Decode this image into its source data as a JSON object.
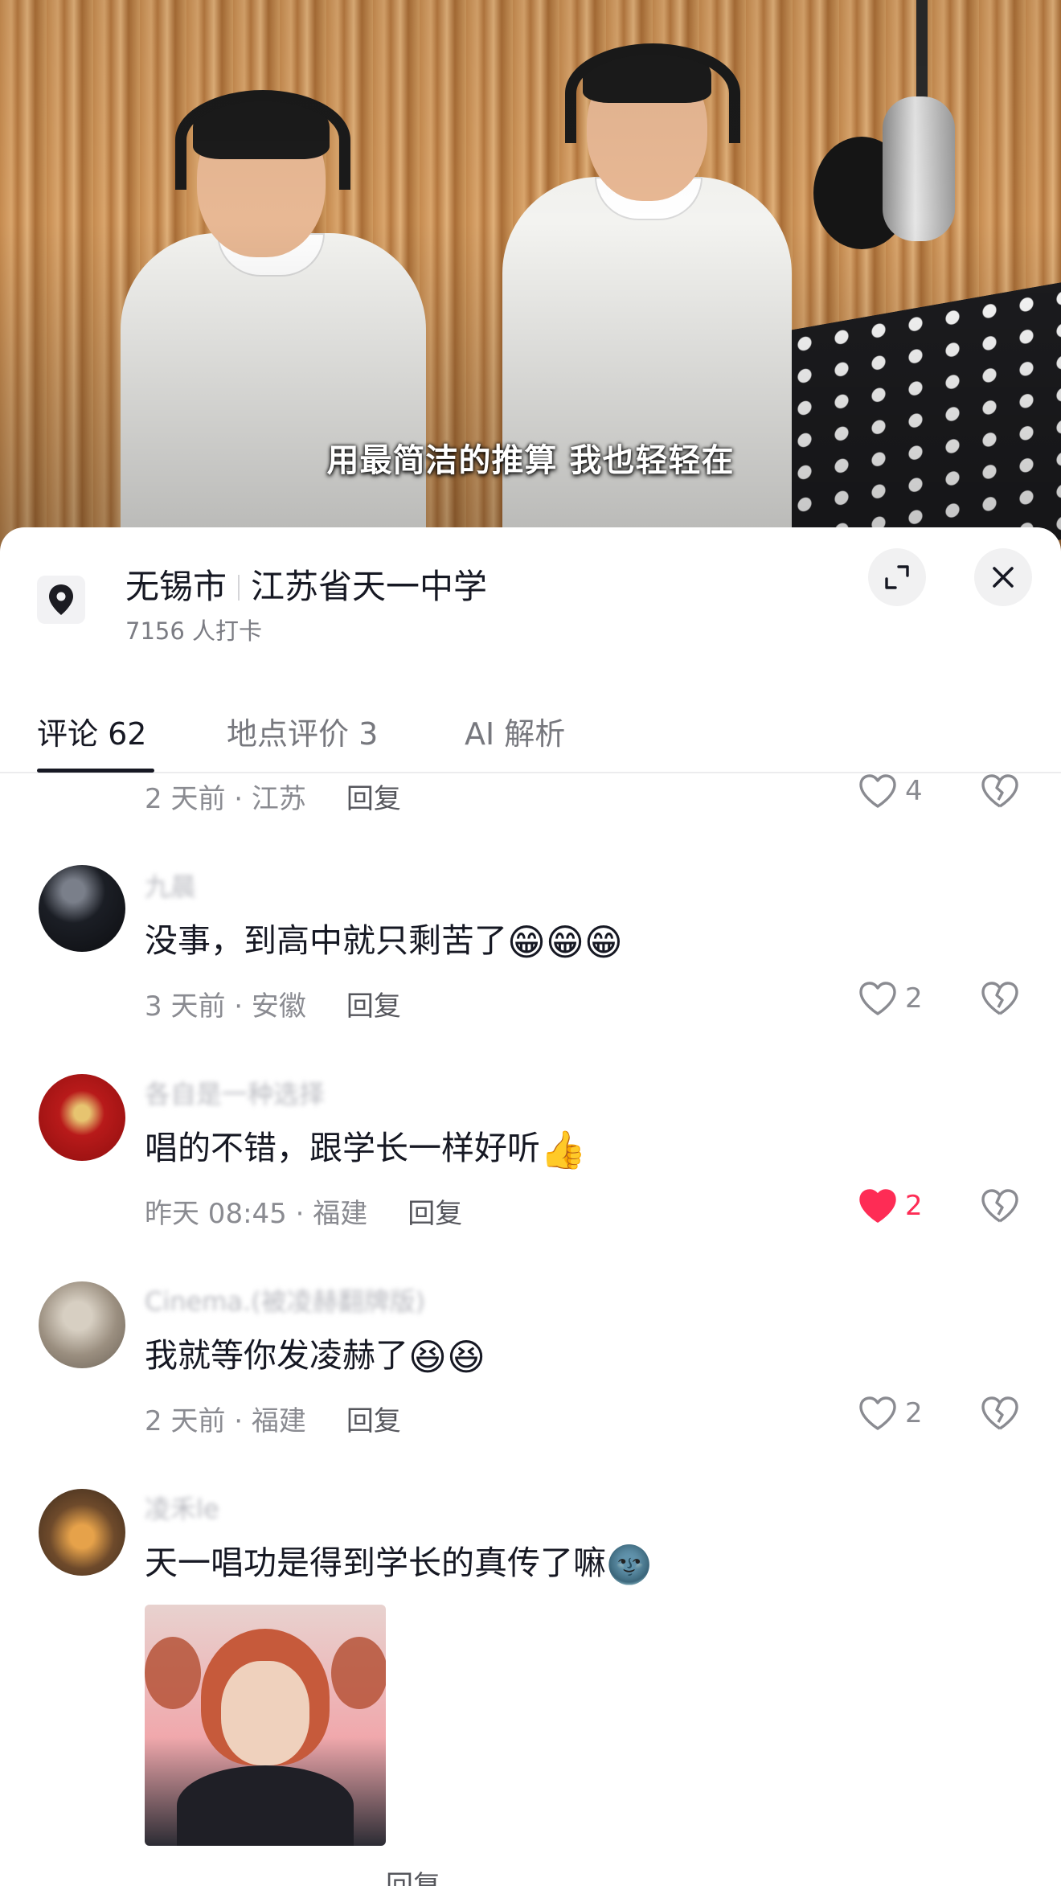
{
  "video": {
    "subtitle": "用最简洁的推算 我也轻轻在"
  },
  "location": {
    "city": "无锡市",
    "place": "江苏省天一中学",
    "checkins": "7156 人打卡",
    "icon": "location-pin-icon"
  },
  "tabs": [
    {
      "label": "评论 62",
      "active": true
    },
    {
      "label": "地点评价 3",
      "active": false
    },
    {
      "label": "AI 解析",
      "active": false
    }
  ],
  "comments": [
    {
      "time_loc": "2 天前 · 江苏",
      "reply": "回复",
      "likes": "4",
      "liked": false
    },
    {
      "user": "九晨",
      "text": "没事，到高中就只剩苦了",
      "emoji": "😁😁😁",
      "time_loc": "3 天前 · 安徽",
      "reply": "回复",
      "likes": "2",
      "liked": false
    },
    {
      "user": "各自是一种选择",
      "text": "唱的不错，跟学长一样好听",
      "emoji": "👍",
      "time_loc": "昨天 08:45 · 福建",
      "reply": "回复",
      "likes": "2",
      "liked": true
    },
    {
      "user": "Cinema.(被凌赫翻牌版)",
      "text": "我就等你发凌赫了",
      "emoji": "😆😆",
      "time_loc": "2 天前 · 福建",
      "reply": "回复",
      "likes": "2",
      "liked": false
    },
    {
      "user": "凌禾le",
      "text": "天一唱功是得到学长的真传了嘛",
      "emoji": "🌚",
      "time_loc": "",
      "reply": "回复",
      "likes": "",
      "liked": false
    }
  ],
  "colors": {
    "accent_like": "#fe2c55",
    "text_primary": "#161823",
    "text_secondary": "#8a8b91"
  }
}
